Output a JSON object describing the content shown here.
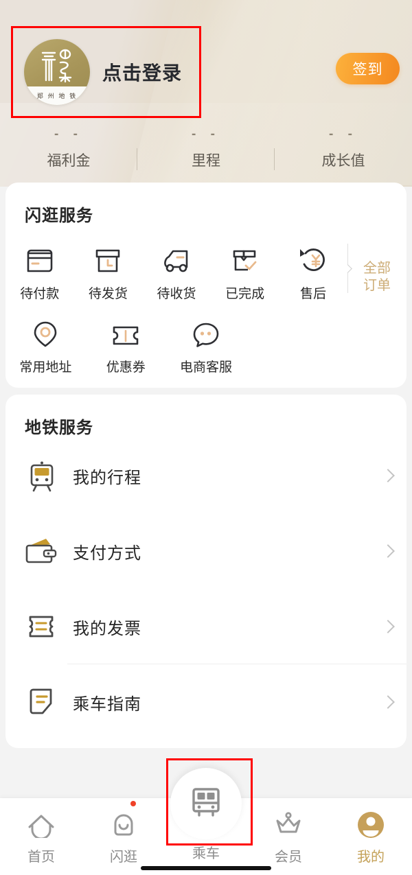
{
  "header": {
    "avatar": {
      "brand_text": "郑 州 地 铁",
      "icon": "zhengzhou-metro-logo"
    },
    "login_text": "点击登录",
    "signin_button": "签到",
    "stats": [
      {
        "value": "- -",
        "label": "福利金"
      },
      {
        "value": "- -",
        "label": "里程"
      },
      {
        "value": "- -",
        "label": "成长值"
      }
    ]
  },
  "shop_card": {
    "title": "闪逛服务",
    "orders": [
      {
        "label": "待付款",
        "icon": "credit-card-icon"
      },
      {
        "label": "待发货",
        "icon": "package-box-icon"
      },
      {
        "label": "待收货",
        "icon": "delivery-truck-icon"
      },
      {
        "label": "已完成",
        "icon": "open-box-check-icon"
      },
      {
        "label": "售后",
        "icon": "refund-yuan-icon"
      }
    ],
    "all_orders": {
      "line1": "全部",
      "line2": "订单"
    },
    "tools": [
      {
        "label": "常用地址",
        "icon": "location-pin-icon"
      },
      {
        "label": "优惠券",
        "icon": "coupon-ticket-icon"
      },
      {
        "label": "电商客服",
        "icon": "chat-bubble-icon"
      }
    ]
  },
  "metro_card": {
    "title": "地铁服务",
    "items": [
      {
        "label": "我的行程",
        "icon": "train-icon"
      },
      {
        "label": "支付方式",
        "icon": "wallet-icon"
      },
      {
        "label": "我的发票",
        "icon": "invoice-ticket-icon"
      },
      {
        "label": "乘车指南",
        "icon": "guide-document-icon"
      }
    ]
  },
  "tabbar": {
    "tabs": [
      {
        "label": "首页",
        "icon": "home-icon",
        "active": false
      },
      {
        "label": "闪逛",
        "icon": "shopping-bag-icon",
        "active": false,
        "badge": true
      },
      {
        "label": "乘车",
        "icon": "metro-train-icon",
        "active": false,
        "center": true
      },
      {
        "label": "会员",
        "icon": "crown-icon",
        "active": false
      },
      {
        "label": "我的",
        "icon": "user-avatar-icon",
        "active": true
      }
    ]
  },
  "colors": {
    "accent_gold": "#c4a158",
    "accent_orange": "#f89a2c",
    "order_icon_accent": "#e8b98c",
    "highlight_red": "#ff0000",
    "header_bg": "#e6ddcb",
    "text_primary": "#262626",
    "text_muted": "#8c8c8c"
  }
}
